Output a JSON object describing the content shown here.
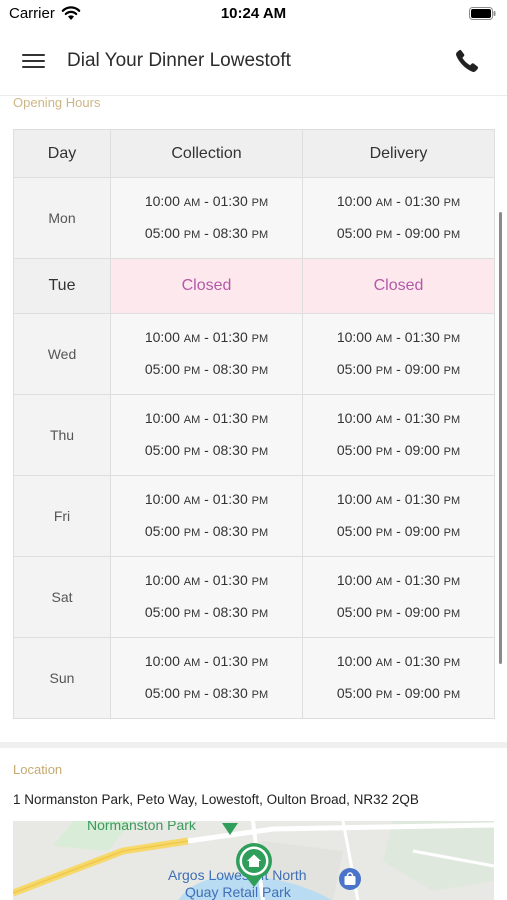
{
  "status_bar": {
    "carrier": "Carrier",
    "time": "10:24 AM"
  },
  "header": {
    "title": "Dial Your Dinner Lowestoft"
  },
  "opening_hours": {
    "heading": "Opening Hours",
    "columns": [
      "Day",
      "Collection",
      "Delivery"
    ],
    "closed_label": "Closed",
    "rows": [
      {
        "day": "Mon",
        "collection": [
          [
            "10:00",
            "AM",
            "01:30",
            "PM"
          ],
          [
            "05:00",
            "PM",
            "08:30",
            "PM"
          ]
        ],
        "delivery": [
          [
            "10:00",
            "AM",
            "01:30",
            "PM"
          ],
          [
            "05:00",
            "PM",
            "09:00",
            "PM"
          ]
        ]
      },
      {
        "day": "Tue",
        "closed": true
      },
      {
        "day": "Wed",
        "collection": [
          [
            "10:00",
            "AM",
            "01:30",
            "PM"
          ],
          [
            "05:00",
            "PM",
            "08:30",
            "PM"
          ]
        ],
        "delivery": [
          [
            "10:00",
            "AM",
            "01:30",
            "PM"
          ],
          [
            "05:00",
            "PM",
            "09:00",
            "PM"
          ]
        ]
      },
      {
        "day": "Thu",
        "collection": [
          [
            "10:00",
            "AM",
            "01:30",
            "PM"
          ],
          [
            "05:00",
            "PM",
            "08:30",
            "PM"
          ]
        ],
        "delivery": [
          [
            "10:00",
            "AM",
            "01:30",
            "PM"
          ],
          [
            "05:00",
            "PM",
            "09:00",
            "PM"
          ]
        ]
      },
      {
        "day": "Fri",
        "collection": [
          [
            "10:00",
            "AM",
            "01:30",
            "PM"
          ],
          [
            "05:00",
            "PM",
            "08:30",
            "PM"
          ]
        ],
        "delivery": [
          [
            "10:00",
            "AM",
            "01:30",
            "PM"
          ],
          [
            "05:00",
            "PM",
            "09:00",
            "PM"
          ]
        ]
      },
      {
        "day": "Sat",
        "collection": [
          [
            "10:00",
            "AM",
            "01:30",
            "PM"
          ],
          [
            "05:00",
            "PM",
            "08:30",
            "PM"
          ]
        ],
        "delivery": [
          [
            "10:00",
            "AM",
            "01:30",
            "PM"
          ],
          [
            "05:00",
            "PM",
            "09:00",
            "PM"
          ]
        ]
      },
      {
        "day": "Sun",
        "collection": [
          [
            "10:00",
            "AM",
            "01:30",
            "PM"
          ],
          [
            "05:00",
            "PM",
            "08:30",
            "PM"
          ]
        ],
        "delivery": [
          [
            "10:00",
            "AM",
            "01:30",
            "PM"
          ],
          [
            "05:00",
            "PM",
            "09:00",
            "PM"
          ]
        ]
      }
    ]
  },
  "location": {
    "heading": "Location",
    "address": "1 Normanston Park, Peto Way, Lowestoft, Oulton Broad, NR32 2QB",
    "map_labels": {
      "park": "Normanston Park",
      "store": "Argos Lowestoft North",
      "retail": "Quay Retail Park"
    }
  },
  "colors": {
    "accent_heading": "#c4aa70",
    "closed_text": "#b45aa8",
    "closed_bg": "#fde8ee",
    "map_pin": "#2e9e5a"
  },
  "icons": {
    "menu": "hamburger-icon",
    "phone": "phone-icon",
    "wifi": "wifi-icon",
    "battery": "battery-icon",
    "pin": "home-pin-icon",
    "shop": "shopping-bag-icon"
  }
}
